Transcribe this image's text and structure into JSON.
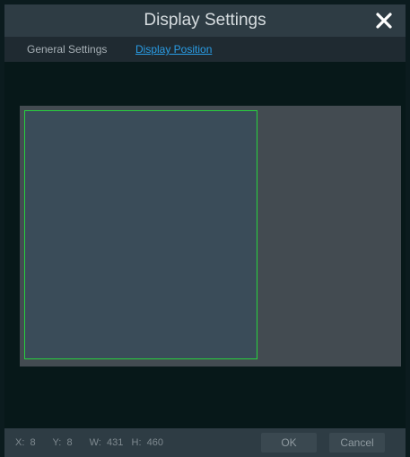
{
  "dialog": {
    "title": "Display Settings",
    "close_icon": "close-icon"
  },
  "tabs": [
    {
      "label": "General Settings",
      "active": false
    },
    {
      "label": "Display Position",
      "active": true
    }
  ],
  "position": {
    "x_label": "X:",
    "x_value": "8",
    "y_label": "Y:",
    "y_value": "8",
    "w_label": "W:",
    "w_value": "431",
    "h_label": "H:",
    "h_value": "460"
  },
  "buttons": {
    "ok_label": "OK",
    "cancel_label": "Cancel"
  },
  "colors": {
    "accent": "#2a9de6",
    "selection_border": "#27d13e"
  }
}
